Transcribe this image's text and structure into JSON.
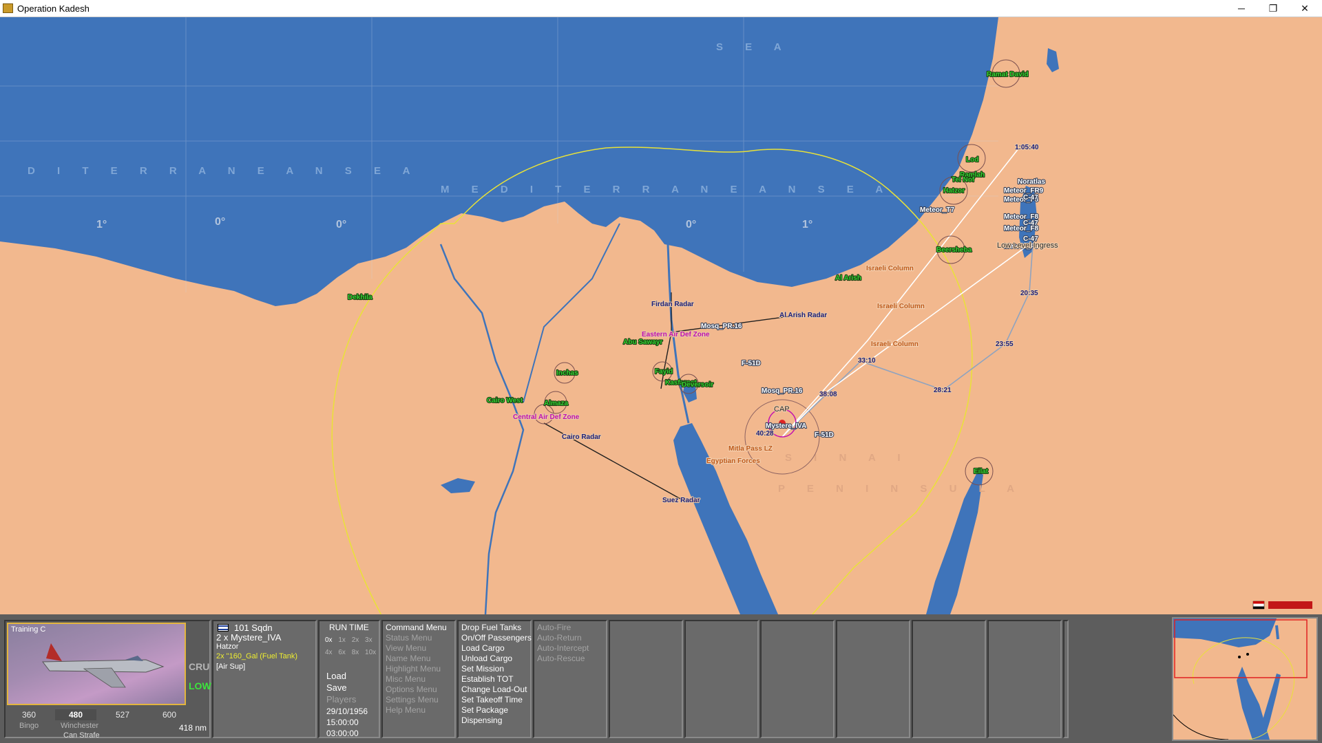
{
  "window": {
    "title": "Operation Kadesh",
    "controls": [
      "─",
      "❐",
      "✕"
    ]
  },
  "map": {
    "sea_label_left": "D I T E R R A N E A N   S E A",
    "sea_label_center": "M E D I T E R R A N E A N   S E A",
    "sea_label_top": "S E A",
    "sinai_label": "S I N A I",
    "peninsula_label": "P E N I N S U L A",
    "grid_labels": [
      "1°",
      "0°",
      "0°",
      "0°",
      "1°"
    ],
    "airbases_green": [
      "Ramat David",
      "Lod",
      "Ramlah",
      "Tel Nof",
      "Hatzor",
      "Beersheba",
      "Al Arish",
      "Eilat",
      "Dekhila",
      "Inchas",
      "Cairo West",
      "Almaza",
      "Abu Sawayr",
      "Fayid",
      "Kasfareet",
      "Deversoir"
    ],
    "radars": [
      "Firdan Radar",
      "Al Arish Radar",
      "Cairo Radar",
      "Suez Radar"
    ],
    "zones": [
      "Eastern Air Def Zone",
      "Central Air Def Zone"
    ],
    "ground": [
      "Israeli Column",
      "Israeli Column",
      "Israeli Column",
      "Mitla Pass LZ",
      "Egyptian Forces"
    ],
    "waypoints": [
      "1:05:40",
      "20:35",
      "23:55",
      "28:21",
      "33:10",
      "38:08",
      "40:28"
    ],
    "units": [
      "F-51D",
      "F-51D",
      "Meteor_T7",
      "Meteor_FR9",
      "Meteor_F8",
      "C-47",
      "Meteor_F8",
      "C-47",
      "Meteor_F8",
      "C-47",
      "Meteor_F8",
      "Noratlas",
      "Mosq_PR.16",
      "Mosq_PR.16",
      "Mystere_IVA"
    ],
    "low_level": "Low Level Ingress",
    "cap": "CAP"
  },
  "unit_panel": {
    "preview_label": "Training C",
    "altitude_labels": [
      "CRU",
      "LOW"
    ],
    "speeds": [
      "360",
      "480",
      "527",
      "600"
    ],
    "bingo": "Bingo",
    "winchester": "Winchester",
    "can_strafe": "Can Strafe",
    "range": "418 nm"
  },
  "flight_info": {
    "squadron": "101 Sqdn",
    "aircraft": "2 x Mystere_IVA",
    "base": "Hatzor",
    "loadout": "2x \"160_Gal (Fuel Tank)",
    "mission": "[Air Sup]"
  },
  "run_time": {
    "title": "RUN TIME",
    "speeds_row1": [
      "0x",
      "1x",
      "2x",
      "3x"
    ],
    "speeds_row2": [
      "4x",
      "6x",
      "8x",
      "10x"
    ],
    "load": "Load",
    "save": "Save",
    "players": "Players",
    "date": "29/10/1956",
    "time": "15:00:00",
    "elapsed": "03:00:00"
  },
  "menus": {
    "main": [
      {
        "label": "Command Menu",
        "enabled": true
      },
      {
        "label": "Status Menu",
        "enabled": false
      },
      {
        "label": "View Menu",
        "enabled": false
      },
      {
        "label": "Name Menu",
        "enabled": false
      },
      {
        "label": "Highlight Menu",
        "enabled": false
      },
      {
        "label": "Misc Menu",
        "enabled": false
      },
      {
        "label": "Options Menu",
        "enabled": false
      },
      {
        "label": "Settings Menu",
        "enabled": false
      },
      {
        "label": "Help Menu",
        "enabled": false
      }
    ],
    "commands": [
      {
        "label": "Drop Fuel Tanks",
        "enabled": true
      },
      {
        "label": "On/Off Passengers",
        "enabled": true
      },
      {
        "label": "Load Cargo",
        "enabled": true
      },
      {
        "label": "Unload Cargo",
        "enabled": true
      },
      {
        "label": "Set Mission",
        "enabled": true
      },
      {
        "label": "Establish TOT",
        "enabled": true
      },
      {
        "label": "Change Load-Out",
        "enabled": true
      },
      {
        "label": "Set Takeoff Time",
        "enabled": true
      },
      {
        "label": "Set Package",
        "enabled": true
      },
      {
        "label": "Dispensing",
        "enabled": true
      }
    ],
    "auto": [
      {
        "label": "Auto-Fire",
        "enabled": false
      },
      {
        "label": "Auto-Return",
        "enabled": false
      },
      {
        "label": "Auto-Intercept",
        "enabled": false
      },
      {
        "label": "Auto-Rescue",
        "enabled": false
      }
    ]
  },
  "colors": {
    "sea": "#3f74ba",
    "land": "#f2b88e",
    "hud": "#5d5d5d",
    "route": "#ffffff",
    "range_ring": "#e9e237",
    "green_label": "#32d132",
    "magenta_label": "#c20fb0"
  }
}
